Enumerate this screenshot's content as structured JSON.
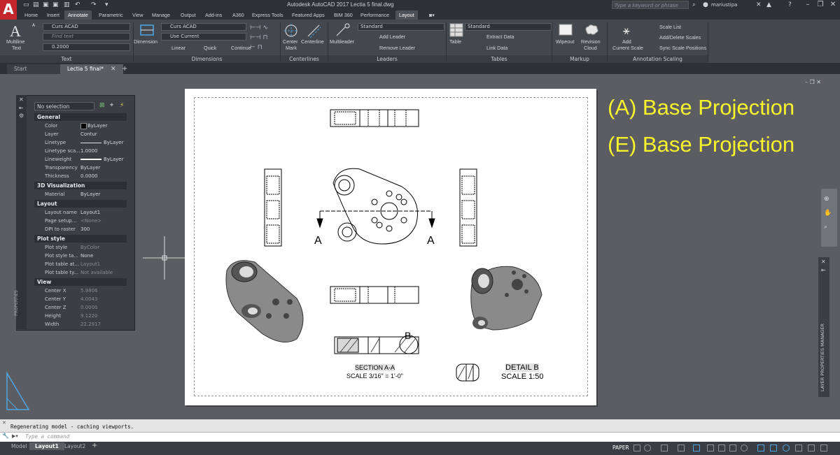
{
  "titlebar": {
    "app_logo": "A",
    "title": "Autodesk AutoCAD 2017    Lectia 5 final.dwg",
    "search_placeholder": "Type a keyword or phrase",
    "user": "mariustipa"
  },
  "ribbon_tabs": [
    "Home",
    "Insert",
    "Annotate",
    "Parametric",
    "View",
    "Manage",
    "Output",
    "Add-ins",
    "A360",
    "Express Tools",
    "Featured Apps",
    "BIM 360",
    "Performance",
    "Layout"
  ],
  "ribbon": {
    "text_panel": {
      "multiline_text": "Multiline",
      "multiline_text2": "Text",
      "style": "Curs ACAD",
      "find_text": "Find text",
      "height": "0.2000",
      "label": "Text"
    },
    "dimensions_panel": {
      "dimension": "Dimension",
      "dim_style": "Curs ACAD",
      "layer": "Use Current",
      "linear": "Linear",
      "quick": "Quick",
      "continue": "Continue",
      "label": "Dimensions"
    },
    "centerlines_panel": {
      "center_mark": "Center",
      "center_mark2": "Mark",
      "centerline": "Centerline",
      "label": "Centerlines"
    },
    "leaders_panel": {
      "multileader": "Multileader",
      "style": "Standard",
      "add_leader": "Add Leader",
      "remove_leader": "Remove Leader",
      "label": "Leaders"
    },
    "tables_panel": {
      "table": "Table",
      "style": "Standard",
      "extract_data": "Extract Data",
      "link_data": "Link Data",
      "label": "Tables"
    },
    "markup_panel": {
      "wipeout": "Wipeout",
      "revision_cloud": "Revision",
      "revision_cloud2": "Cloud",
      "label": "Markup"
    },
    "annotation_scaling_panel": {
      "add_current_scale": "Add",
      "add_current_scale2": "Current Scale",
      "scale_list": "Scale List",
      "add_delete_scales": "Add/Delete Scales",
      "sync_scale_positions": "Sync Scale Positions",
      "label": "Annotation Scaling"
    }
  },
  "file_tabs": [
    "Start",
    "Lectia 5 final*"
  ],
  "properties": {
    "selection": "No selection",
    "side_label": "PROPERTIES",
    "sections": [
      {
        "title": "General",
        "rows": [
          [
            "Color",
            "ByLayer"
          ],
          [
            "Layer",
            "Contur"
          ],
          [
            "Linetype",
            "ByLayer"
          ],
          [
            "Linetype sca...",
            "1.0000"
          ],
          [
            "Lineweight",
            "ByLayer"
          ],
          [
            "Transparency",
            "ByLayer"
          ],
          [
            "Thickness",
            "0.0000"
          ]
        ]
      },
      {
        "title": "3D Visualization",
        "rows": [
          [
            "Material",
            "ByLayer"
          ]
        ]
      },
      {
        "title": "Layout",
        "rows": [
          [
            "Layout name",
            "Layout1"
          ],
          [
            "Page setup...",
            "<None>"
          ],
          [
            "DPI to raster",
            "300"
          ]
        ]
      },
      {
        "title": "Plot style",
        "rows": [
          [
            "Plot style",
            "ByColor"
          ],
          [
            "Plot style ta...",
            "None"
          ],
          [
            "Plot table at...",
            "Layout1"
          ],
          [
            "Plot table ty...",
            "Not available"
          ]
        ]
      },
      {
        "title": "View",
        "rows": [
          [
            "Center X",
            "5.9806"
          ],
          [
            "Center Y",
            "4.0043"
          ],
          [
            "Center Z",
            "0.0000"
          ],
          [
            "Height",
            "9.1220"
          ],
          [
            "Width",
            "22.2917"
          ]
        ]
      }
    ]
  },
  "drawing": {
    "overlay_a": "(A) Base Projection",
    "overlay_e": "(E) Base Projection",
    "section_mark_left": "A",
    "section_mark_right": "A",
    "detail_mark": "B",
    "section_label": "SECTION A-A",
    "section_scale": "SCALE 3/16\" = 1'-0\"",
    "detail_label": "DETAIL B",
    "detail_scale": "SCALE 1:50"
  },
  "layer_manager": "LAYER PROPERTIES MANAGER",
  "command": {
    "history": "Regenerating model - caching viewports.",
    "placeholder": "Type a command"
  },
  "layout_tabs": [
    "Model",
    "Layout1",
    "Layout2"
  ],
  "status": {
    "paper": "PAPER"
  }
}
